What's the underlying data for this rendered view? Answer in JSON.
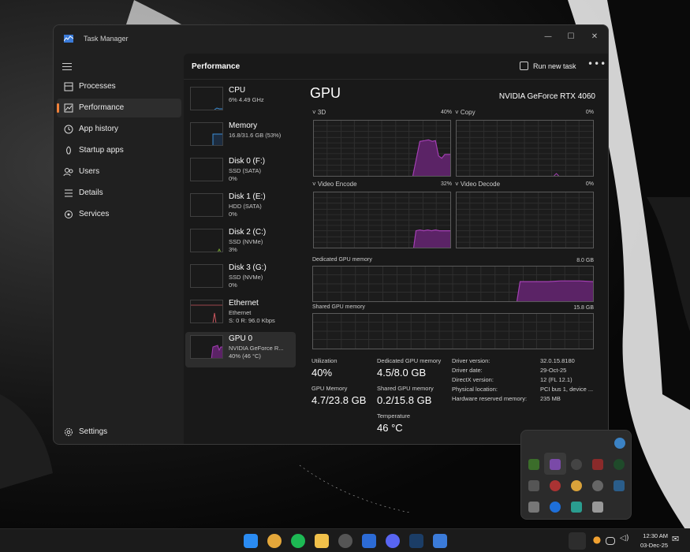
{
  "window": {
    "title": "Task Manager"
  },
  "nav": {
    "items": [
      {
        "label": "Processes",
        "icon": "processes-icon"
      },
      {
        "label": "Performance",
        "icon": "performance-icon",
        "active": true
      },
      {
        "label": "App history",
        "icon": "history-icon"
      },
      {
        "label": "Startup apps",
        "icon": "startup-icon"
      },
      {
        "label": "Users",
        "icon": "users-icon"
      },
      {
        "label": "Details",
        "icon": "details-icon"
      },
      {
        "label": "Services",
        "icon": "services-icon"
      }
    ],
    "settings_label": "Settings"
  },
  "header": {
    "title": "Performance",
    "run_task_label": "Run new task",
    "more_label": "•••"
  },
  "devices": [
    {
      "name": "CPU",
      "s1": "6%  4.49 GHz",
      "s2": "",
      "s3": ""
    },
    {
      "name": "Memory",
      "s1": "16.8/31.6 GB (53%)",
      "s2": "",
      "s3": ""
    },
    {
      "name": "Disk 0 (F:)",
      "s1": "SSD (SATA)",
      "s2": "0%",
      "s3": ""
    },
    {
      "name": "Disk 1 (E:)",
      "s1": "HDD (SATA)",
      "s2": "0%",
      "s3": ""
    },
    {
      "name": "Disk 2 (C:)",
      "s1": "SSD (NVMe)",
      "s2": "3%",
      "s3": ""
    },
    {
      "name": "Disk 3 (G:)",
      "s1": "SSD (NVMe)",
      "s2": "0%",
      "s3": ""
    },
    {
      "name": "Ethernet",
      "s1": "Ethernet",
      "s2": "S: 0  R: 96.0 Kbps",
      "s3": ""
    },
    {
      "name": "GPU 0",
      "s1": "NVIDIA GeForce R...",
      "s2": "40% (46 °C)",
      "s3": ""
    }
  ],
  "gpu": {
    "title": "GPU",
    "model": "NVIDIA GeForce RTX 4060",
    "engines": [
      {
        "label": "3D",
        "value": "40%"
      },
      {
        "label": "Copy",
        "value": "0%"
      },
      {
        "label": "Video Encode",
        "value": "32%"
      },
      {
        "label": "Video Decode",
        "value": "0%"
      }
    ],
    "dedicated_label": "Dedicated GPU memory",
    "dedicated_max": "8.0 GB",
    "shared_label": "Shared GPU memory",
    "shared_max": "15.8 GB",
    "stats": {
      "utilization_label": "Utilization",
      "utilization": "40%",
      "dedicated_label": "Dedicated GPU memory",
      "dedicated": "4.5/8.0 GB",
      "gpu_memory_label": "GPU Memory",
      "gpu_memory": "4.7/23.8 GB",
      "shared_label": "Shared GPU memory",
      "shared": "0.2/15.8 GB",
      "temp_label": "Temperature",
      "temp": "46 °C"
    },
    "info": [
      {
        "k": "Driver version:",
        "v": "32.0.15.8180"
      },
      {
        "k": "Driver date:",
        "v": "29-Oct-25"
      },
      {
        "k": "DirectX version:",
        "v": "12 (FL 12.1)"
      },
      {
        "k": "Physical location:",
        "v": "PCI bus 1, device ..."
      },
      {
        "k": "Hardware reserved memory:",
        "v": "235 MB"
      }
    ]
  },
  "taskbar": {
    "time": "12:30 AM",
    "date": "03-Dec-25"
  },
  "colors": {
    "accent": "#f0813a",
    "gpu_graph": "#a43fb4",
    "gpu_fill": "#5b2366"
  }
}
